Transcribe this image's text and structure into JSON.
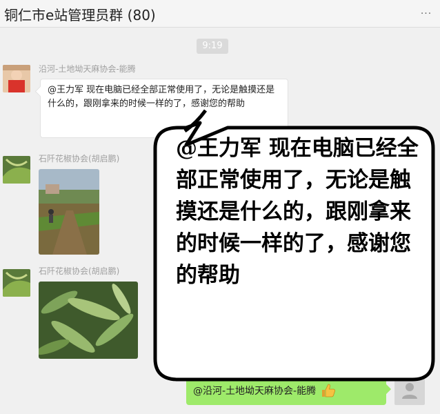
{
  "window": {
    "title": "铜仁市e站管理员群 (80)"
  },
  "chat": {
    "time": "9:19",
    "messages": [
      {
        "sender": "沿河-土地坳天麻协会-能腾",
        "text": "@王力军 现在电脑已经全部正常使用了，无论是触摸还是什么的，跟刚拿来的时候一样的了，感谢您的帮助"
      },
      {
        "sender": "石阡花椒协会(胡启鹏)",
        "type": "image"
      },
      {
        "sender": "石阡花椒协会(胡启鹏)",
        "type": "image"
      }
    ],
    "my_message": {
      "text": "@沿河-土地坳天麻协会-能腾",
      "emoji": "thumbs-up-icon"
    }
  },
  "callout": {
    "text": "@王力军 现在电脑已经全部正常使用了，无论是触摸还是什么的，跟刚拿来的时候一样的了，感谢您的帮助"
  },
  "colors": {
    "my_bubble": "#9eea6a",
    "time_badge": "#dadada",
    "background": "#f0f0f0"
  }
}
